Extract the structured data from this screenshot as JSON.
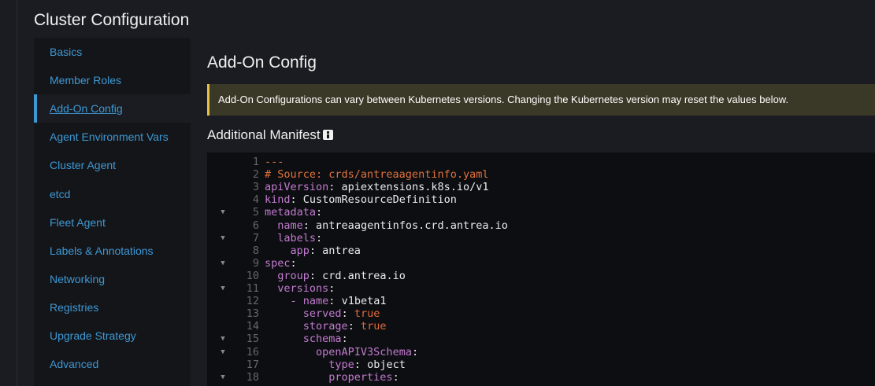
{
  "page": {
    "title": "Cluster Configuration"
  },
  "sidebar": {
    "items": [
      {
        "label": "Basics",
        "active": false
      },
      {
        "label": "Member Roles",
        "active": false
      },
      {
        "label": "Add-On Config",
        "active": true
      },
      {
        "label": "Agent Environment Vars",
        "active": false
      },
      {
        "label": "Cluster Agent",
        "active": false
      },
      {
        "label": "etcd",
        "active": false
      },
      {
        "label": "Fleet Agent",
        "active": false
      },
      {
        "label": "Labels & Annotations",
        "active": false
      },
      {
        "label": "Networking",
        "active": false
      },
      {
        "label": "Registries",
        "active": false
      },
      {
        "label": "Upgrade Strategy",
        "active": false
      },
      {
        "label": "Advanced",
        "active": false
      }
    ]
  },
  "content": {
    "title": "Add-On Config",
    "banner": "Add-On Configurations can vary between Kubernetes versions. Changing the Kubernetes version may reset the values below.",
    "section_title": "Additional Manifest"
  },
  "editor": {
    "lines": [
      {
        "n": "1",
        "fold": false,
        "parts": [
          [
            "c",
            "---"
          ]
        ]
      },
      {
        "n": "2",
        "fold": false,
        "parts": [
          [
            "c",
            "# Source: crds/antreaagentinfo.yaml"
          ]
        ]
      },
      {
        "n": "3",
        "fold": false,
        "parts": [
          [
            "k",
            "apiVersion"
          ],
          [
            "p",
            ": "
          ],
          [
            "v",
            "apiextensions.k8s.io/v1"
          ]
        ]
      },
      {
        "n": "4",
        "fold": false,
        "parts": [
          [
            "k",
            "kind"
          ],
          [
            "p",
            ": "
          ],
          [
            "v",
            "CustomResourceDefinition"
          ]
        ]
      },
      {
        "n": "5",
        "fold": true,
        "parts": [
          [
            "k",
            "metadata"
          ],
          [
            "p",
            ":"
          ]
        ]
      },
      {
        "n": "6",
        "fold": false,
        "parts": [
          [
            "p",
            "  "
          ],
          [
            "k",
            "name"
          ],
          [
            "p",
            ": "
          ],
          [
            "v",
            "antreaagentinfos.crd.antrea.io"
          ]
        ]
      },
      {
        "n": "7",
        "fold": true,
        "parts": [
          [
            "p",
            "  "
          ],
          [
            "k",
            "labels"
          ],
          [
            "p",
            ":"
          ]
        ]
      },
      {
        "n": "8",
        "fold": false,
        "parts": [
          [
            "p",
            "    "
          ],
          [
            "k",
            "app"
          ],
          [
            "p",
            ": "
          ],
          [
            "v",
            "antrea"
          ]
        ]
      },
      {
        "n": "9",
        "fold": true,
        "parts": [
          [
            "k",
            "spec"
          ],
          [
            "p",
            ":"
          ]
        ]
      },
      {
        "n": "10",
        "fold": false,
        "parts": [
          [
            "p",
            "  "
          ],
          [
            "k",
            "group"
          ],
          [
            "p",
            ": "
          ],
          [
            "v",
            "crd.antrea.io"
          ]
        ]
      },
      {
        "n": "11",
        "fold": true,
        "parts": [
          [
            "p",
            "  "
          ],
          [
            "k",
            "versions"
          ],
          [
            "p",
            ":"
          ]
        ]
      },
      {
        "n": "12",
        "fold": false,
        "parts": [
          [
            "p",
            "    "
          ],
          [
            "k",
            "- "
          ],
          [
            "k",
            "name"
          ],
          [
            "p",
            ": "
          ],
          [
            "v",
            "v1beta1"
          ]
        ]
      },
      {
        "n": "13",
        "fold": false,
        "parts": [
          [
            "p",
            "      "
          ],
          [
            "k",
            "served"
          ],
          [
            "p",
            ": "
          ],
          [
            "b",
            "true"
          ]
        ]
      },
      {
        "n": "14",
        "fold": false,
        "parts": [
          [
            "p",
            "      "
          ],
          [
            "k",
            "storage"
          ],
          [
            "p",
            ": "
          ],
          [
            "b",
            "true"
          ]
        ]
      },
      {
        "n": "15",
        "fold": true,
        "parts": [
          [
            "p",
            "      "
          ],
          [
            "k",
            "schema"
          ],
          [
            "p",
            ":"
          ]
        ]
      },
      {
        "n": "16",
        "fold": true,
        "parts": [
          [
            "p",
            "        "
          ],
          [
            "k",
            "openAPIV3Schema"
          ],
          [
            "p",
            ":"
          ]
        ]
      },
      {
        "n": "17",
        "fold": false,
        "parts": [
          [
            "p",
            "          "
          ],
          [
            "k",
            "type"
          ],
          [
            "p",
            ": "
          ],
          [
            "v",
            "object"
          ]
        ]
      },
      {
        "n": "18",
        "fold": true,
        "parts": [
          [
            "p",
            "          "
          ],
          [
            "k",
            "properties"
          ],
          [
            "p",
            ":"
          ]
        ]
      }
    ]
  }
}
